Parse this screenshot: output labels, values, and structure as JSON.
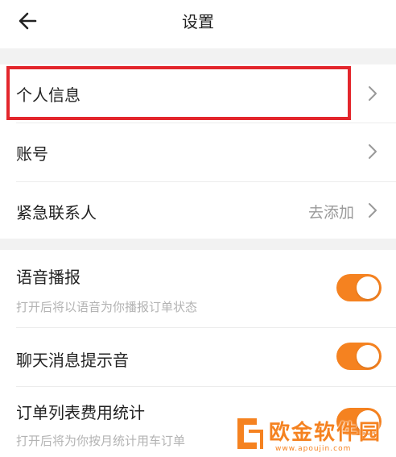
{
  "header": {
    "back_icon": "arrow-left-icon",
    "title": "设置"
  },
  "menu": {
    "personal_info": {
      "label": "个人信息",
      "highlighted": true
    },
    "account": {
      "label": "账号"
    },
    "emergency_contact": {
      "label": "紧急联系人",
      "value": "去添加"
    }
  },
  "settings": {
    "voice_broadcast": {
      "label": "语音播报",
      "description": "打开后将以语音为你播报订单状态",
      "enabled": true
    },
    "chat_sound": {
      "label": "聊天消息提示音",
      "enabled": true
    },
    "order_fee_stats": {
      "label": "订单列表费用统计",
      "description": "打开后将为你按月统计用车订单",
      "enabled": true
    }
  },
  "colors": {
    "accent": "#f58220",
    "highlight_box": "#e3262c",
    "section_gap": "#f2f2f2"
  },
  "watermark": {
    "text": "欧金软件园",
    "url": "www.apoujin.com"
  }
}
